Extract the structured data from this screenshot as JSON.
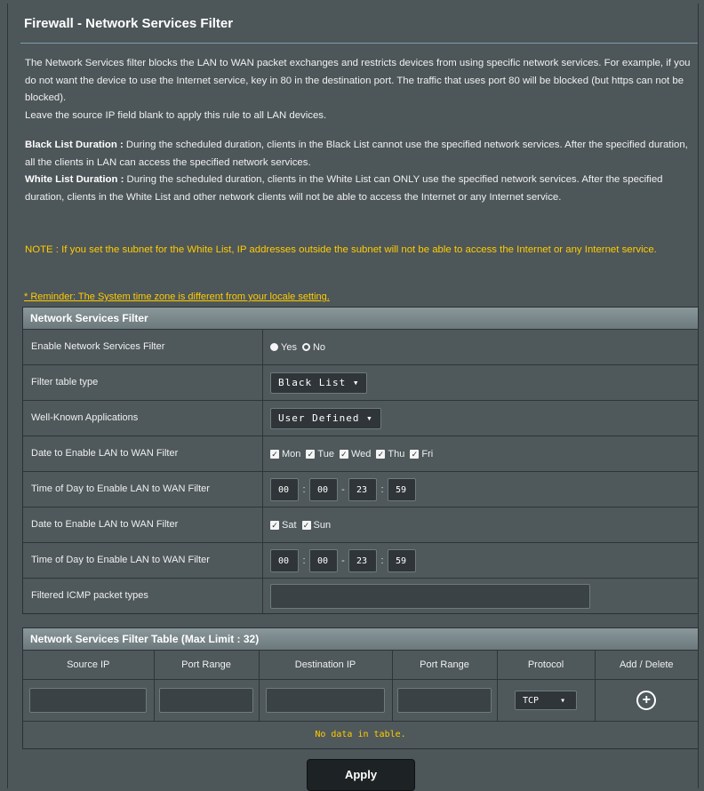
{
  "page": {
    "title": "Firewall - Network Services Filter",
    "desc1": "The Network Services filter blocks the LAN to WAN packet exchanges and restricts devices from using specific network services. For example, if you do not want the device to use the Internet service, key in 80 in the destination port. The traffic that uses port 80 will be blocked (but https can not be blocked).",
    "desc2": "Leave the source IP field blank to apply this rule to all LAN devices.",
    "black_title": "Black List Duration :",
    "black_text": " During the scheduled duration, clients in the Black List cannot use the specified network services. After the specified duration, all the clients in LAN can access the specified network services.",
    "white_title": "White List Duration :",
    "white_text": " During the scheduled duration, clients in the White List can ONLY use the specified network services. After the specified duration, clients in the White List and other network clients will not be able to access the Internet or any Internet service.",
    "note": "NOTE : If you set the subnet for the White List, IP addresses outside the subnet will not be able to access the Internet or any Internet service.",
    "reminder": "* Reminder: The System time zone is different from your locale setting."
  },
  "filter": {
    "header": "Network Services Filter",
    "enable_label": "Enable Network Services Filter",
    "yes": "Yes",
    "no": "No",
    "table_type_label": "Filter table type",
    "table_type_value": "Black List ▾",
    "apps_label": "Well-Known Applications",
    "apps_value": "User Defined ▾",
    "weekday_label": "Date to Enable LAN to WAN Filter",
    "weekdays": [
      "Mon",
      "Tue",
      "Wed",
      "Thu",
      "Fri"
    ],
    "weekday_time_label": "Time of Day to Enable LAN to WAN Filter",
    "weekday_time": [
      "00",
      "00",
      "23",
      "59"
    ],
    "weekend_label": "Date to Enable LAN to WAN Filter",
    "weekend": [
      "Sat",
      "Sun"
    ],
    "weekend_time_label": "Time of Day to Enable LAN to WAN Filter",
    "weekend_time": [
      "00",
      "00",
      "23",
      "59"
    ],
    "icmp_label": "Filtered ICMP packet types"
  },
  "table": {
    "header": "Network Services Filter Table (Max Limit : 32)",
    "columns": [
      "Source IP",
      "Port Range",
      "Destination IP",
      "Port Range",
      "Protocol",
      "Add / Delete"
    ],
    "protocol_value": "TCP",
    "protocol_arrow": "▾",
    "add_symbol": "+",
    "empty": "No data in table."
  },
  "apply_label": "Apply"
}
